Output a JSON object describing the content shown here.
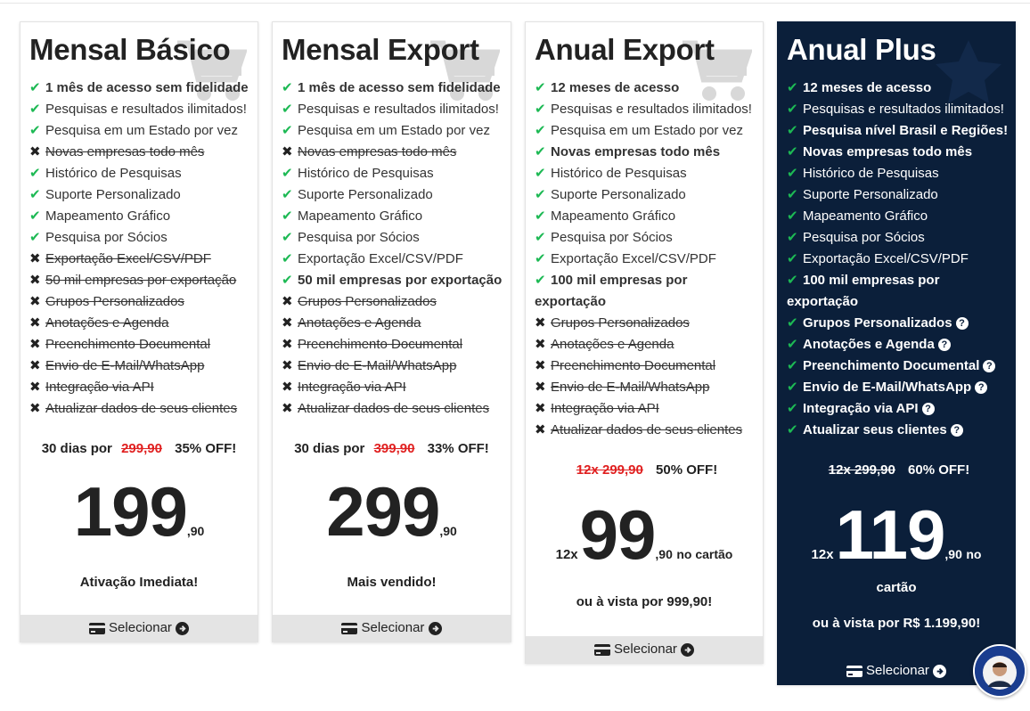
{
  "plans": [
    {
      "title": "Mensal Básico",
      "features": [
        {
          "text": "1 mês de acesso sem fidelidade",
          "on": true,
          "bold": true
        },
        {
          "text": "Pesquisas e resultados ilimitados!",
          "on": true
        },
        {
          "text": "Pesquisa em um Estado por vez",
          "on": true
        },
        {
          "text": "Novas empresas todo mês",
          "on": false
        },
        {
          "text": "Histórico de Pesquisas",
          "on": true
        },
        {
          "text": "Suporte Personalizado",
          "on": true
        },
        {
          "text": "Mapeamento Gráfico",
          "on": true
        },
        {
          "text": "Pesquisa por Sócios",
          "on": true
        },
        {
          "text": "Exportação Excel/CSV/PDF",
          "on": false
        },
        {
          "text": "50 mil empresas por exportação",
          "on": false
        },
        {
          "text": "Grupos Personalizados",
          "on": false
        },
        {
          "text": "Anotações e Agenda",
          "on": false
        },
        {
          "text": "Preenchimento Documental",
          "on": false
        },
        {
          "text": "Envio de E-Mail/WhatsApp",
          "on": false
        },
        {
          "text": "Integração via API",
          "on": false
        },
        {
          "text": "Atualizar dados de seus clientes",
          "on": false
        }
      ],
      "offer_prefix": "30 dias por",
      "old_price": "299,90",
      "discount": "35% OFF!",
      "price_prefix": "",
      "price_int": "199",
      "price_cents": ",90",
      "price_suffix": "",
      "note": "Ativação Imediata!",
      "select_label": "Selecionar"
    },
    {
      "title": "Mensal Export",
      "features": [
        {
          "text": "1 mês de acesso sem fidelidade",
          "on": true,
          "bold": true
        },
        {
          "text": "Pesquisas e resultados ilimitados!",
          "on": true
        },
        {
          "text": "Pesquisa em um Estado por vez",
          "on": true
        },
        {
          "text": "Novas empresas todo mês",
          "on": false
        },
        {
          "text": "Histórico de Pesquisas",
          "on": true
        },
        {
          "text": "Suporte Personalizado",
          "on": true
        },
        {
          "text": "Mapeamento Gráfico",
          "on": true
        },
        {
          "text": "Pesquisa por Sócios",
          "on": true
        },
        {
          "text": "Exportação Excel/CSV/PDF",
          "on": true
        },
        {
          "text": "50 mil empresas por exportação",
          "on": true,
          "bold": true
        },
        {
          "text": "Grupos Personalizados",
          "on": false
        },
        {
          "text": "Anotações e Agenda",
          "on": false
        },
        {
          "text": "Preenchimento Documental",
          "on": false
        },
        {
          "text": "Envio de E-Mail/WhatsApp",
          "on": false
        },
        {
          "text": "Integração via API",
          "on": false
        },
        {
          "text": "Atualizar dados de seus clientes",
          "on": false
        }
      ],
      "offer_prefix": "30 dias por",
      "old_price": "399,90",
      "discount": "33% OFF!",
      "price_prefix": "",
      "price_int": "299",
      "price_cents": ",90",
      "price_suffix": "",
      "note": "Mais vendido!",
      "select_label": "Selecionar"
    },
    {
      "title": "Anual Export",
      "features": [
        {
          "text": "12 meses de acesso",
          "on": true,
          "bold": true
        },
        {
          "text": "Pesquisas e resultados ilimitados!",
          "on": true
        },
        {
          "text": "Pesquisa em um Estado por vez",
          "on": true
        },
        {
          "text": "Novas empresas todo mês",
          "on": true,
          "bold": true
        },
        {
          "text": "Histórico de Pesquisas",
          "on": true
        },
        {
          "text": "Suporte Personalizado",
          "on": true
        },
        {
          "text": "Mapeamento Gráfico",
          "on": true
        },
        {
          "text": "Pesquisa por Sócios",
          "on": true
        },
        {
          "text": "Exportação Excel/CSV/PDF",
          "on": true
        },
        {
          "text": "100 mil empresas por exportação",
          "on": true,
          "bold": true,
          "wrap": true
        },
        {
          "text": "Grupos Personalizados",
          "on": false
        },
        {
          "text": "Anotações e Agenda",
          "on": false
        },
        {
          "text": "Preenchimento Documental",
          "on": false
        },
        {
          "text": "Envio de E-Mail/WhatsApp",
          "on": false
        },
        {
          "text": "Integração via API",
          "on": false
        },
        {
          "text": "Atualizar dados de seus clientes",
          "on": false
        }
      ],
      "offer_prefix": "",
      "old_price": "12x 299,90",
      "discount": "50% OFF!",
      "price_prefix": "12x",
      "price_int": "99",
      "price_cents": ",90",
      "price_suffix": "no cartão",
      "note": "ou à vista por 999,90!",
      "select_label": "Selecionar"
    },
    {
      "title": "Anual Plus",
      "features": [
        {
          "text": "12 meses de acesso",
          "on": true,
          "bold": true
        },
        {
          "text": "Pesquisas e resultados ilimitados!",
          "on": true
        },
        {
          "text": "Pesquisa nível Brasil e Regiões!",
          "on": true,
          "bold": true
        },
        {
          "text": "Novas empresas todo mês",
          "on": true,
          "bold": true
        },
        {
          "text": "Histórico de Pesquisas",
          "on": true
        },
        {
          "text": "Suporte Personalizado",
          "on": true
        },
        {
          "text": "Mapeamento Gráfico",
          "on": true
        },
        {
          "text": "Pesquisa por Sócios",
          "on": true
        },
        {
          "text": "Exportação Excel/CSV/PDF",
          "on": true
        },
        {
          "text": "100 mil empresas por exportação",
          "on": true,
          "bold": true,
          "wrap": true
        },
        {
          "text": "Grupos Personalizados",
          "on": true,
          "bold": true,
          "help": true
        },
        {
          "text": "Anotações e Agenda",
          "on": true,
          "bold": true,
          "help": true
        },
        {
          "text": "Preenchimento Documental",
          "on": true,
          "bold": true,
          "help": true
        },
        {
          "text": "Envio de E-Mail/WhatsApp",
          "on": true,
          "bold": true,
          "help": true
        },
        {
          "text": "Integração via API",
          "on": true,
          "bold": true,
          "help": true
        },
        {
          "text": "Atualizar seus clientes",
          "on": true,
          "bold": true,
          "help": true
        }
      ],
      "offer_prefix": "",
      "old_price": "12x 299,90",
      "discount": "60% OFF!",
      "price_prefix": "12x",
      "price_int": "119",
      "price_cents": ",90",
      "price_suffix": "no",
      "price_suffix2": "cartão",
      "note": "ou à vista por R$ 1.199,90!",
      "select_label": "Selecionar"
    }
  ],
  "icons": {
    "check": "check-icon",
    "cross": "cross-icon",
    "cart": "cart-icon",
    "star": "star-icon",
    "card": "credit-card-icon",
    "arrow": "arrow-circle-right-icon",
    "help": "question-circle-icon"
  },
  "colors": {
    "check": "#1db954",
    "old_price": "#e02020",
    "dark_card": "#0b1f3a",
    "select_bar": "#e4e4e4"
  },
  "help_glyph": "?",
  "check_glyph": "✔",
  "cross_glyph": "✖"
}
